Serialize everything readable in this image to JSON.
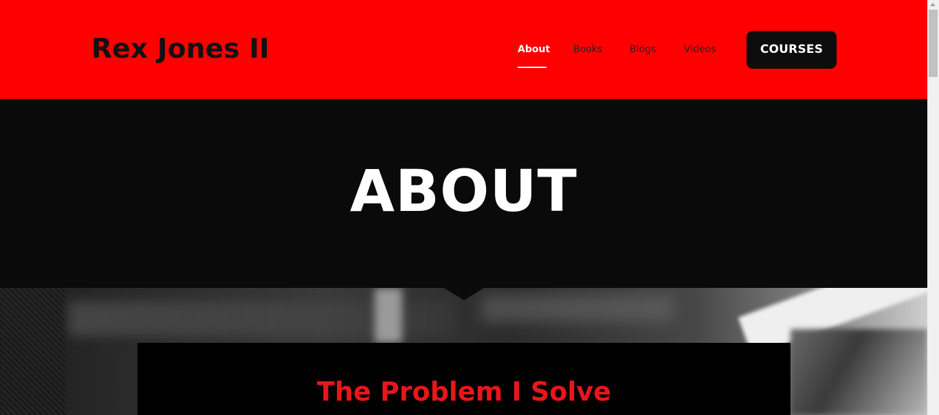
{
  "header": {
    "logo_text": "Rex Jones II",
    "brand_color": "#ff0000",
    "nav": [
      {
        "label": "About",
        "active": true
      },
      {
        "label": "Books",
        "active": false
      },
      {
        "label": "Blogs",
        "active": false
      },
      {
        "label": "Videos",
        "active": false
      }
    ],
    "cta_label": "COURSES"
  },
  "hero": {
    "title": "ABOUT",
    "background_color": "#0a0a0b"
  },
  "section": {
    "title": "The Problem I Solve",
    "title_color": "#e8161b"
  }
}
